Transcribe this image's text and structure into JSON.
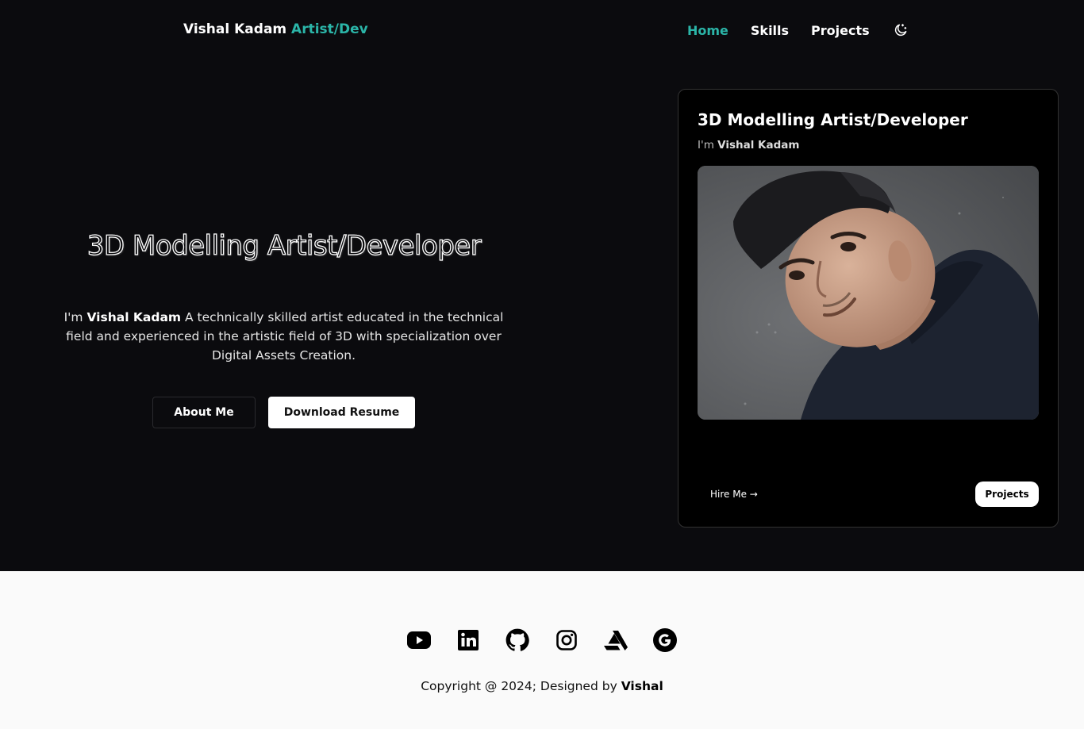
{
  "header": {
    "brand_name": "Vishal Kadam",
    "brand_accent": "Artist/Dev",
    "nav": [
      "Home",
      "Skills",
      "Projects"
    ],
    "active_nav": "Home",
    "theme_icon": "moon-stars-icon"
  },
  "hero": {
    "title": "3D Modelling Artist/Developer",
    "intro_prefix": "I'm",
    "name": "Vishal Kadam",
    "description": "A technically skilled artist educated in the technical field and experienced in the artistic field of 3D with specialization over Digital Assets Creation.",
    "about_button": "About Me",
    "resume_button": "Download Resume"
  },
  "card": {
    "title": "3D Modelling Artist/Developer",
    "intro_prefix": "I'm",
    "name": "Vishal Kadam",
    "hire_link": "Hire Me →",
    "projects_button": "Projects"
  },
  "footer": {
    "social_icons": [
      "youtube-icon",
      "linkedin-icon",
      "github-icon",
      "instagram-icon",
      "artstation-icon",
      "google-icon"
    ],
    "copyright_prefix": "Copyright @ 2024; Designed by",
    "designer": "Vishal"
  },
  "colors": {
    "accent": "#2bb5a8",
    "background_dark": "#0b0b0e",
    "footer_background": "#fafafa"
  }
}
